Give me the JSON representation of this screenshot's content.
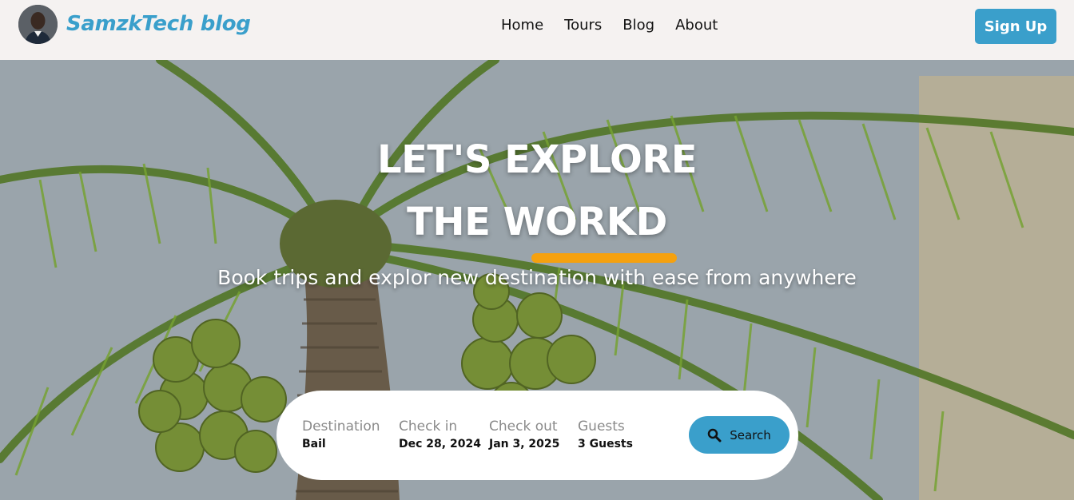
{
  "navbar": {
    "brand": "SamzkTech blog",
    "links": [
      "Home",
      "Tours",
      "Blog",
      "About"
    ],
    "signup_label": "Sign Up"
  },
  "hero": {
    "title_line_1": "LET'S EXPLORE",
    "title_line_2": "THE WORKD",
    "subtitle": "Book trips and explor new destination with ease from anywhere"
  },
  "search": {
    "fields": [
      {
        "label": "Destination",
        "value": "Bail"
      },
      {
        "label": "Check in",
        "value": "Dec 28, 2024"
      },
      {
        "label": "Check out",
        "value": "Jan 3, 2025"
      },
      {
        "label": "Guests",
        "value": "3 Guests"
      }
    ],
    "button_label": "Search",
    "button_icon": "search-icon"
  },
  "colors": {
    "accent": "#3a9fcb",
    "underline": "#f5a10f",
    "navbar_bg": "#f5f2f1"
  }
}
